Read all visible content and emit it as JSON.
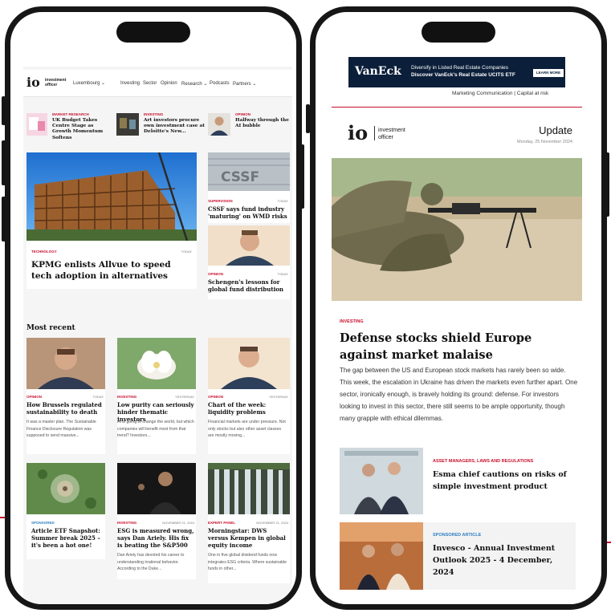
{
  "left": {
    "logo": {
      "mark": "io",
      "line1": "investment",
      "line2": "officer"
    },
    "nav": {
      "region": "Luxembourg",
      "items": [
        "Investing",
        "Sector",
        "Opinion",
        "Research",
        "Podcasts",
        "Partners"
      ]
    },
    "top_strip": [
      {
        "tag": "MARKET RESEARCH",
        "title": "UK Budget Takes Centre Stage as Growth Momentum Softens"
      },
      {
        "tag": "INVESTING",
        "title": "Art investors procure own investment case at Deloitte's New..."
      },
      {
        "tag": "OPINION",
        "title": "Halfway through the AI bubble"
      }
    ],
    "feature": {
      "tag": "TECHNOLOGY",
      "date": "TODAY",
      "title": "KPMG enlists Allvue to speed tech adoption in alternatives"
    },
    "side_cards": [
      {
        "tag": "SUPERVISION",
        "date": "TODAY",
        "title": "CSSF says fund industry 'maturing' on WMD risks",
        "thumb_text": "CSSF"
      },
      {
        "tag": "OPINION",
        "date": "TODAY",
        "title": "Schengen's lessons for global fund distribution"
      }
    ],
    "most_recent_title": "Most recent",
    "recent": [
      {
        "tag": "OPINION",
        "date": "TODAY",
        "title": "How Brussels regulated sustainability to death",
        "excerpt": "It was a master plan. The Sustainable Finance Disclosure Regulation was supposed to send massive..."
      },
      {
        "tag": "INVESTING",
        "date": "YESTERDAY",
        "title": "Low purity can seriously hinder thematic investors",
        "excerpt": "AI is going to change the world, but which companies will benefit most from that trend? Investors..."
      },
      {
        "tag": "OPINION",
        "date": "YESTERDAY",
        "title": "Chart of the week: liquidity problems",
        "excerpt": "Financial markets are under pressure. Not only stocks but also other asset classes are mostly moving..."
      }
    ],
    "bottom": [
      {
        "tag": "SPONSORED",
        "date": "",
        "title": "Article ETF Snapshot: Summer break 2025 – it's been a hot one!",
        "excerpt": ""
      },
      {
        "tag": "INVESTING",
        "date": "NOVEMBER 21, 2024",
        "title": "ESG is measured wrong, says Dan Ariely. His fix is beating the S&P500",
        "excerpt": "Dan Ariely has devoted his career to understanding irrational behavior. According to the Duke..."
      },
      {
        "tag": "EXPERT PANEL",
        "date": "NOVEMBER 21, 2024",
        "title": "Morningstar: DWS versus Kempen in global equity income",
        "excerpt": "One in five global dividend funds now integrates ESG criteria. Where sustainable funds in other..."
      }
    ]
  },
  "right": {
    "banner": {
      "logo": "VanEck",
      "line1": "Diversify in Listed Real Estate Companies",
      "line2": "Discover VanEck's Real Estate UCITS ETF",
      "button": "LEARN MORE",
      "footer": "Marketing Communication | Capital at risk"
    },
    "logo": {
      "mark": "io",
      "line1": "investment",
      "line2": "officer"
    },
    "update_title": "Update",
    "update_date": "Monday, 25 November 2024",
    "lead": {
      "tag": "INVESTING",
      "title": "Defense stocks shield Europe against market malaise",
      "body": "The gap between the US and European stock markets has rarely been so wide. This week, the escalation in Ukraine has driven the markets even further apart. One sector, ironically enough, is bravely holding its ground: defense. For investors looking to invest in this sector, there still seems to be ample opportunity, though many grapple with ethical dilemmas."
    },
    "items": [
      {
        "tag": "ASSET MANAGERS, LAWS AND REGULATIONS",
        "title": "Esma chief cautions on risks of simple investment product"
      },
      {
        "tag": "SPONSORED ARTICLE",
        "title": "Invesco - Annual Investment Outlook 2025 - 4 December, 2024"
      }
    ]
  },
  "colors": {
    "accent": "#c8102e",
    "sponsored": "#2f7fc3",
    "banner_bg": "#0b1f3a"
  }
}
